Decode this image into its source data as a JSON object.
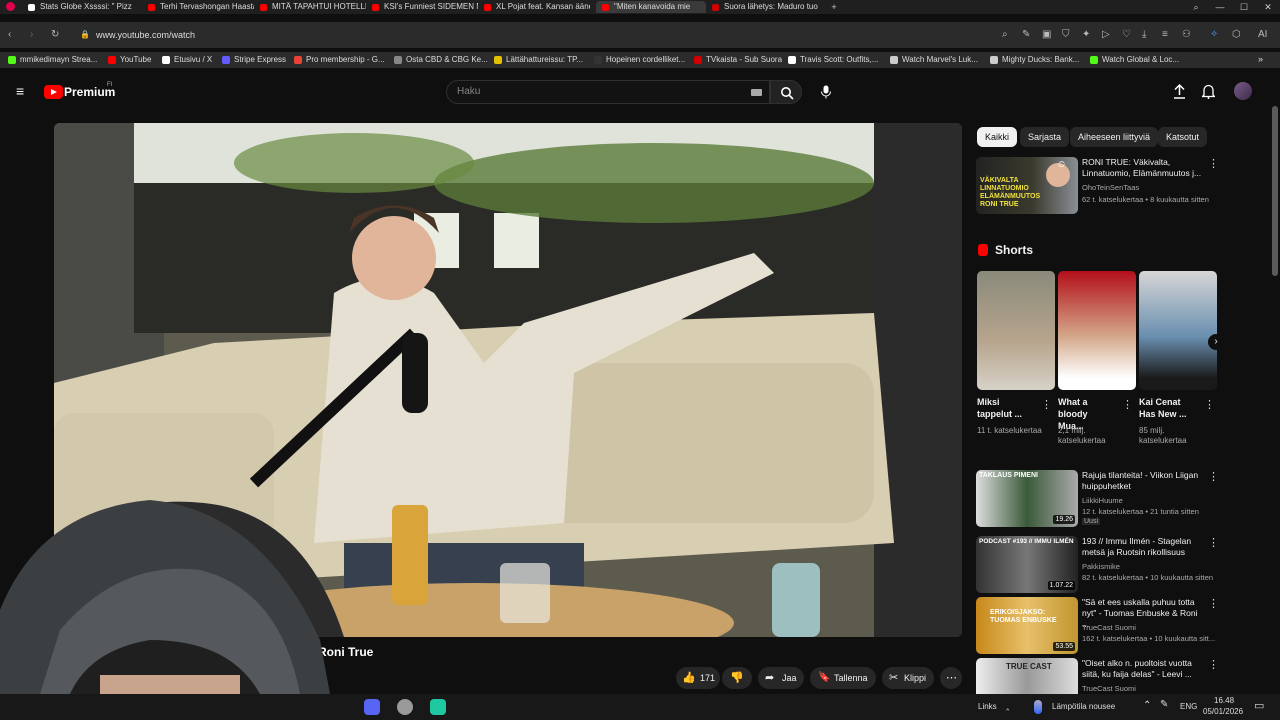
{
  "tabs": [
    {
      "title": "Stats Globe Xssssi: \" Pizz",
      "active": false
    },
    {
      "title": "Terhi Tervashongan Haastatt",
      "active": false
    },
    {
      "title": "MITÄ TAPAHTUI HOTELLISSA?",
      "active": false
    },
    {
      "title": "KSI's Funniest SIDEMEN Mom",
      "active": false
    },
    {
      "title": "XL Pojat feat. Kansan äänet",
      "active": false
    },
    {
      "title": "\"Miten kanavoida mie",
      "active": true
    },
    {
      "title": "Suora lähetys: Maduro tuomi",
      "active": false
    }
  ],
  "address": {
    "url": "www.youtube.com/watch"
  },
  "bookmarks": [
    {
      "label": "mmikedimayn Strea...",
      "color": "#53fc18"
    },
    {
      "label": "YouTube",
      "color": "#ff0000"
    },
    {
      "label": "Etusivu / X",
      "color": "#ffffff"
    },
    {
      "label": "Stripe Express",
      "color": "#635bff"
    },
    {
      "label": "Pro membership - G...",
      "color": "#ea4335"
    },
    {
      "label": "Osta CBD & CBG Ke...",
      "color": "#888888"
    },
    {
      "label": "Lättähattureissu: TP...",
      "color": "#e0c000"
    },
    {
      "label": "Hopeinen cordelliket...",
      "color": "#333333"
    },
    {
      "label": "TVkaista - Sub Suora",
      "color": "#d00000"
    },
    {
      "label": "Travis Scott: Outfits,...",
      "color": "#ffffff"
    },
    {
      "label": "Watch Marvel's Luk...",
      "color": "#cccccc"
    },
    {
      "label": "Mighty Ducks: Bank...",
      "color": "#cccccc"
    },
    {
      "label": "Watch Global & Loc...",
      "color": "#53fc18"
    }
  ],
  "yt": {
    "logo": "Premium",
    "logo_region": "FI",
    "search_placeholder": "Haku"
  },
  "video": {
    "channel_name": "Roni True"
  },
  "actions": {
    "like_count": "171",
    "share": "Jaa",
    "save": "Tallenna",
    "clip": "Klippi"
  },
  "chips": [
    {
      "label": "Kaikki",
      "selected": true
    },
    {
      "label": "Sarjasta",
      "selected": false
    },
    {
      "label": "Aiheeseen liittyviä",
      "selected": false
    },
    {
      "label": "Katsotut",
      "selected": false
    }
  ],
  "recommended_top": {
    "title": "RONI TRUE: Väkivalta, Linnatuomio, Elämänmuutos j...",
    "channel": "OhoTeinSenTaas",
    "meta": "62 t. katselukertaa • 8 kuukautta sitten",
    "thumb_text": "VÄKIVALTA LINNATUOMIO ELÄMÄNMUUTOS RONI TRUE"
  },
  "shorts_header": "Shorts",
  "shorts": [
    {
      "title": "Miksi tappelut ...",
      "views": "11 t. katselukertaa"
    },
    {
      "title": "What a bloody Mua...",
      "views": "2,1 milj. katselukertaa"
    },
    {
      "title": "Kai Cenat Has New ...",
      "views": "85 milj. katselukertaa"
    }
  ],
  "recommended": [
    {
      "title": "Rajuja tilanteita! - Viikon Liigan huippuhetket",
      "channel": "LiikkiHuume",
      "meta": "12 t. katselukertaa • 21 tuntia sitten",
      "badge": "Uusi",
      "duration": "19.26",
      "thumb_text": "TAKLAUS PIMENI"
    },
    {
      "title": "193 // Immu Ilmén - Stagelan metsä ja Ruotsin rikollisuus",
      "channel": "Pakkismike",
      "meta": "82 t. katselukertaa • 10 kuukautta sitten",
      "badge": "",
      "duration": "1.07.22",
      "thumb_text": "PODCAST #193 // IMMU ILMÉN"
    },
    {
      "title": "\"Sä et ees uskalla puhuu totta nyt\" - Tuomas Enbuske & Roni ...",
      "channel": "TrueCast Suomi",
      "meta": "162 t. katselukertaa • 10 kuukautta sitt...",
      "badge": "",
      "duration": "53.55",
      "thumb_text": "ERIKOISJAKSO: TUOMAS ENBUSKE"
    },
    {
      "title": "\"Oiset alko n. puoltoist vuotta siitä, ku faija delas\" - Leevi ...",
      "channel": "TrueCast Suomi",
      "meta": "",
      "badge": "",
      "duration": "",
      "thumb_text": "TRUE CAST"
    }
  ],
  "taskbar": {
    "links": "Links",
    "weather": "Lämpötila nousee",
    "lang": "ENG",
    "time": "16.48",
    "date": "05/01/2026"
  },
  "colors": {
    "accent": "#ff0000",
    "bg": "#0f0f0f",
    "chip": "#272727"
  }
}
